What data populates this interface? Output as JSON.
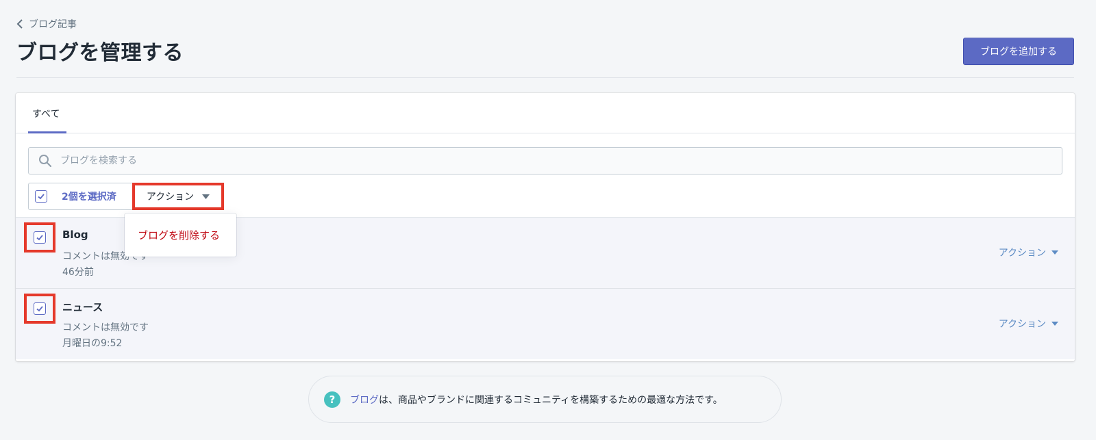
{
  "breadcrumb": {
    "label": "ブログ記事"
  },
  "page": {
    "title": "ブログを管理する",
    "add_button": "ブログを追加する"
  },
  "tabs": [
    {
      "label": "すべて",
      "active": true
    }
  ],
  "search": {
    "placeholder": "ブログを検索する",
    "value": ""
  },
  "bulk": {
    "selected_count_label": "2個を選択済",
    "action_label": "アクション"
  },
  "dropdown": {
    "items": [
      {
        "label": "ブログを削除する",
        "destructive": true
      }
    ]
  },
  "blogs": [
    {
      "title": "Blog",
      "comments": "コメントは無効です",
      "updated": "46分前",
      "action_label": "アクション",
      "checked": true
    },
    {
      "title": "ニュース",
      "comments": "コメントは無効です",
      "updated": "月曜日の9:52",
      "action_label": "アクション",
      "checked": true
    }
  ],
  "footer": {
    "link_text": "ブログ",
    "text": "は、商品やブランドに関連するコミュニティを構築するための最適な方法です。"
  },
  "icons": {
    "back": "chevron-left-icon",
    "search": "search-icon",
    "check": "check-icon",
    "caret": "caret-down-icon",
    "help": "question-circle-icon"
  },
  "colors": {
    "primary": "#5c6ac4",
    "highlight": "#e5392b",
    "destructive": "#bf0711",
    "help": "#47c1bf",
    "link": "#5c8bc4"
  }
}
